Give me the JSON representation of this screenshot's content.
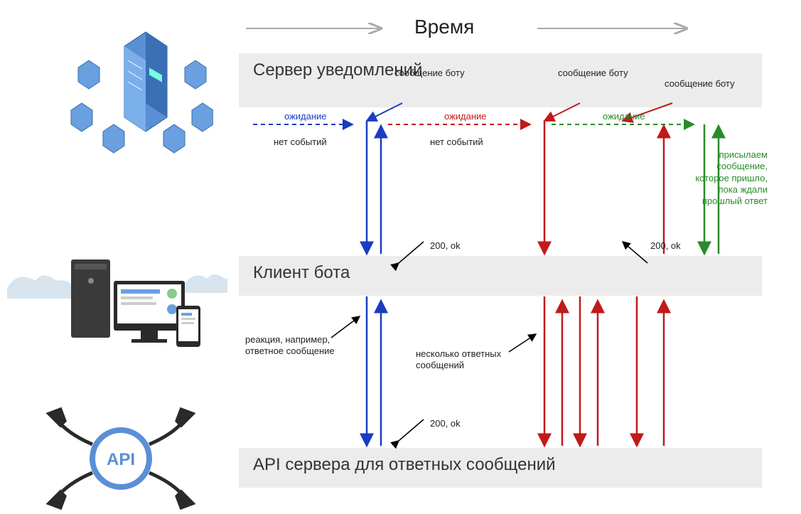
{
  "timeline": {
    "label": "Время",
    "arrow_left_label": "",
    "arrow_right_label": ""
  },
  "lanes": {
    "notif_server": "Сервер уведомлений",
    "bot_client": "Клиент бота",
    "api_server": "API сервера для ответных сообщений"
  },
  "waiting": {
    "blue": "ожидание",
    "red": "ожидание",
    "green": "ожидание"
  },
  "no_events": {
    "a": "нет событий",
    "b": "нет событий"
  },
  "msg_to_bot": {
    "a": "сообщение боту",
    "b": "сообщение боту",
    "c": "сообщение боту"
  },
  "status": {
    "top_a": "200, ok",
    "top_b": "200, ok",
    "bottom": "200, ok"
  },
  "reaction": "реакция, например,\nответное сообщение",
  "multi_resp": "несколько ответных\nсообщений",
  "queued_msg": "присылаем\nсообщение,\nкоторое пришло,\nпока ждали\nпрошлый ответ",
  "icons": {
    "servers": "servers-cluster-icon",
    "client": "client-devices-icon",
    "api": "api-plug-icon"
  },
  "colors": {
    "blue": "#1a3cc0",
    "red": "#c01a1a",
    "green": "#2a8a2a",
    "lane_bg": "#ececec",
    "gray_arrow": "#aaaaaa"
  }
}
